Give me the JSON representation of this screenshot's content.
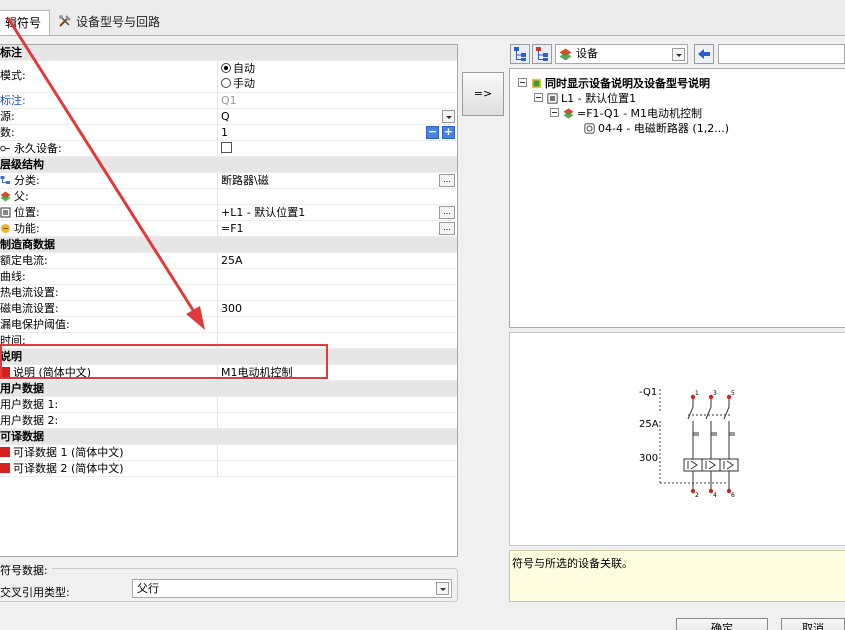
{
  "tabs": [
    {
      "label": "编辑符号",
      "visible_label": "辑符号",
      "active": true
    },
    {
      "label": "设备型号与回路",
      "active": false
    }
  ],
  "grid": {
    "rows": [
      {
        "type": "cat",
        "key": "标注"
      },
      {
        "type": "prop",
        "key": "模式:",
        "v_auto": "自动",
        "v_manual": "手动",
        "selected": "自动"
      },
      {
        "type": "prop",
        "key": "标注:",
        "value": "Q1",
        "key_color": "blue",
        "value_color": "gray"
      },
      {
        "type": "prop",
        "key": "源:",
        "value": "Q"
      },
      {
        "type": "prop",
        "key": "数:",
        "value": "1"
      },
      {
        "type": "prop",
        "key": "永久设备:",
        "value": ""
      },
      {
        "type": "cat",
        "key": "层级结构"
      },
      {
        "type": "prop",
        "key": "分类:",
        "value": "断路器\\磁"
      },
      {
        "type": "prop",
        "key": "父:",
        "value": ""
      },
      {
        "type": "prop",
        "key": "位置:",
        "value": "+L1 - 默认位置1"
      },
      {
        "type": "prop",
        "key": "功能:",
        "value": "=F1"
      },
      {
        "type": "cat",
        "key": "制造商数据"
      },
      {
        "type": "prop",
        "key": "额定电流:",
        "value": "25A"
      },
      {
        "type": "prop",
        "key": "曲线:",
        "value": ""
      },
      {
        "type": "prop",
        "key": "热电流设置:",
        "value": ""
      },
      {
        "type": "prop",
        "key": "磁电流设置:",
        "value": "300"
      },
      {
        "type": "prop",
        "key": "漏电保护阈值:",
        "value": ""
      },
      {
        "type": "prop",
        "key": "时间:",
        "value": ""
      },
      {
        "type": "cat",
        "key": "说明"
      },
      {
        "type": "prop",
        "key": "说明 (简体中文)",
        "value": "M1电动机控制"
      },
      {
        "type": "cat",
        "key": "用户数据"
      },
      {
        "type": "prop",
        "key": "用户数据 1:",
        "value": ""
      },
      {
        "type": "prop",
        "key": "用户数据 2:",
        "value": ""
      },
      {
        "type": "cat",
        "key": "可译数据"
      },
      {
        "type": "prop",
        "key": "可译数据 1 (简体中文)",
        "value": ""
      },
      {
        "type": "prop",
        "key": "可译数据 2 (简体中文)",
        "value": ""
      }
    ]
  },
  "symbol_data": {
    "group_title": "符号数据:",
    "ref_type_label": "交叉引用类型:",
    "ref_type_value": "父行"
  },
  "assign_button": "=>",
  "device_combo": "设备",
  "tree": [
    {
      "level": 0,
      "label": "同时显示设备说明及设备型号说明",
      "bold": true
    },
    {
      "level": 1,
      "label": "L1 - 默认位置1"
    },
    {
      "level": 2,
      "label": "=F1-Q1 - M1电动机控制"
    },
    {
      "level": 3,
      "label": "04-4 - 电磁断路器 (1,2...)"
    }
  ],
  "preview": {
    "tag": "-Q1",
    "rating": "25A",
    "setting": "300",
    "top_terminals": [
      "1",
      "3",
      "5"
    ],
    "bottom_terminals": [
      "2",
      "4",
      "6"
    ]
  },
  "status_text": "符号与所选的设备关联。",
  "buttons": {
    "ok": "确定",
    "cancel": "取消"
  },
  "colors": {
    "annotation_red": "#e23a3a",
    "status_bg": "#fffde0",
    "link_blue": "#1f4fd6"
  }
}
